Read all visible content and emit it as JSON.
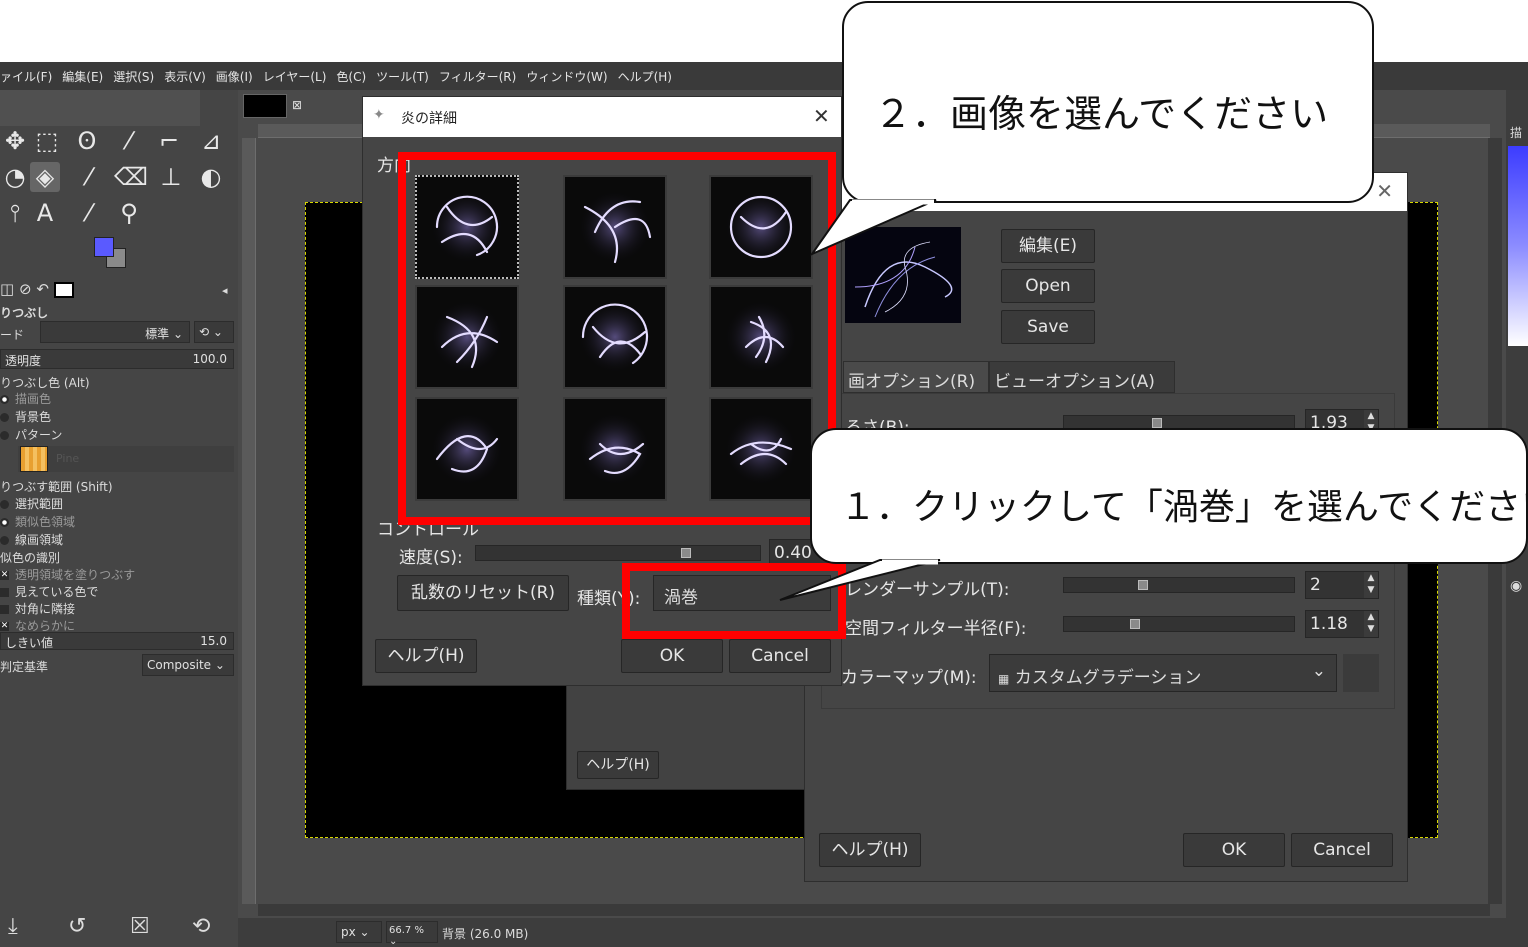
{
  "menubar": {
    "items": [
      "ァイル(F)",
      "編集(E)",
      "選択(S)",
      "表示(V)",
      "画像(I)",
      "レイヤー(L)",
      "色(C)",
      "ツール(T)",
      "フィルター(R)",
      "ウィンドウ(W)",
      "ヘルプ(H)"
    ]
  },
  "tool_options": {
    "title": "りつぶし",
    "mode_label": "ード",
    "mode_value": "標準",
    "opacity_label": "透明度",
    "opacity_value": "100.0",
    "fill_color_header": "りつぶし色 (Alt)",
    "fill_fg": "描画色",
    "fill_bg": "背景色",
    "fill_pattern": "パターン",
    "pattern_name": "Pine",
    "fill_area_header": "りつぶす範囲 (Shift)",
    "area_selection": "選択範囲",
    "area_similar": "類似色領域",
    "area_line": "線画領域",
    "similar_header": "似色の識別",
    "fill_transparent": "透明領域を塗りつぶす",
    "sample_merged": "見えている色で",
    "diagonal": "対角に隣接",
    "antialias": "なめらかに",
    "threshold_label": "しきい値",
    "threshold_value": "15.0",
    "criterion_label": "判定基準",
    "criterion_value": "Composite"
  },
  "flame_designer": {
    "title": "炎の詳細",
    "directions_label": "方向",
    "controls_label": "コントロール",
    "speed_label": "速度(S):",
    "speed_value": "0.40",
    "speed_fraction": 0.76,
    "reset_button": "乱数のリセット(R)",
    "type_label": "種類(Y):",
    "type_value": "渦巻",
    "help_button": "ヘルプ(H)",
    "ok_button": "OK",
    "cancel_button": "Cancel"
  },
  "flame_main": {
    "edit_button": "編集(E)",
    "open_button": "Open",
    "save_button": "Save",
    "tab_render": "画オプション(R)",
    "tab_view": "ビューオプション(A)",
    "brightness_label": "るさ(B):",
    "brightness_value": "1.93",
    "supersample_label": "レンダーサンプル(T):",
    "supersample_value": "2",
    "filter_radius_label": "空間フィルター半径(F):",
    "filter_radius_value": "1.18",
    "colormap_label": "カラーマップ(M):",
    "colormap_value": "カスタムグラデーション",
    "help_button": "ヘルプ(H)",
    "ok_button": "OK",
    "cancel_button": "Cancel"
  },
  "middle_dialog": {
    "help_button": "ヘルプ(H)"
  },
  "statusbar": {
    "unit": "px",
    "zoom": "66.7 %",
    "layer_info": "背景 (26.0 MB)"
  },
  "right_dock": {
    "label": "描"
  },
  "callouts": {
    "step2": "２．画像を選んでください",
    "step1": "１．クリックして「渦巻」を選んでください"
  },
  "colors": {
    "highlight_red": "#ff0000",
    "fg_color": "#5a5aff",
    "panel_bg": "#454545"
  }
}
